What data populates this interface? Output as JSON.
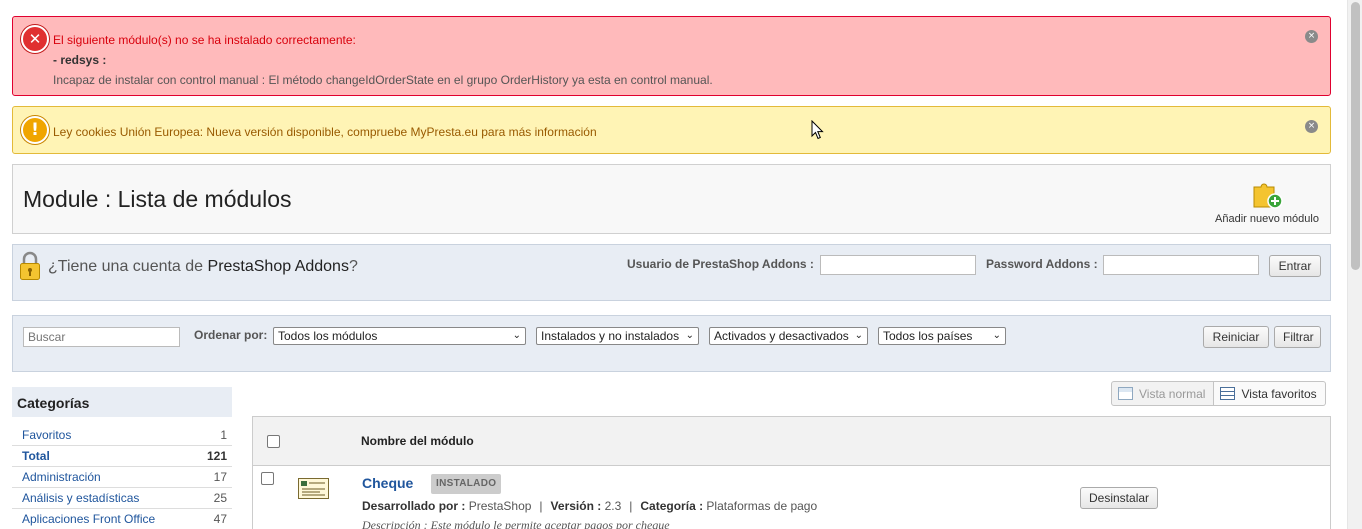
{
  "alerts": {
    "error": {
      "title": "El siguiente módulo(s) no se ha instalado correctamente:",
      "module": "- redsys :",
      "message": "Incapaz de instalar con control manual : El método changeIdOrderState en el grupo OrderHistory ya esta en control manual.",
      "icon": "error-x-icon",
      "close_glyph": "×"
    },
    "warning": {
      "text": "Ley cookies Unión Europea: Nueva versión disponible, compruebe MyPresta.eu para más información",
      "icon": "exclamation-icon",
      "close_glyph": "×"
    }
  },
  "header": {
    "title": "Module : Lista de módulos",
    "add_module_label": "Añadir nuevo módulo"
  },
  "addons": {
    "question_prefix": "¿Tiene una cuenta de ",
    "question_brand": "PrestaShop Addons",
    "question_suffix": "?",
    "user_label": "Usuario de PrestaShop Addons :",
    "password_label": "Password Addons :",
    "user_value": "",
    "password_value": "",
    "submit_label": "Entrar"
  },
  "filters": {
    "search_placeholder": "Buscar",
    "sort_label": "Ordenar por:",
    "select_modules": "Todos los módulos",
    "select_installed": "Instalados y no instalados",
    "select_active": "Activados y desactivados",
    "select_country": "Todos los países",
    "reset_label": "Reiniciar",
    "filter_label": "Filtrar"
  },
  "categories": {
    "title": "Categorías",
    "items": [
      {
        "name": "Favoritos",
        "count": "1"
      },
      {
        "name": "Total",
        "count": "121"
      },
      {
        "name": "Administración",
        "count": "17"
      },
      {
        "name": "Análisis y estadísticas",
        "count": "25"
      },
      {
        "name": "Aplicaciones Front Office",
        "count": "47"
      }
    ]
  },
  "views": {
    "normal_label": "Vista normal",
    "favorites_label": "Vista favoritos"
  },
  "module_table": {
    "column_name": "Nombre del módulo",
    "rows": [
      {
        "name": "Cheque",
        "status": "INSTALADO",
        "developer_label": "Desarrollado por :",
        "developer": "PrestaShop",
        "version_label": "Versión :",
        "version": "2.3",
        "category_label": "Categoría :",
        "category": "Plataformas de pago",
        "description": "Descripción : Este módulo le permite aceptar pagos por cheque",
        "action_label": "Desinstalar"
      }
    ]
  },
  "colors": {
    "error_bg": "#ffbabb",
    "error_text": "#d8000c",
    "warning_bg": "#fff4b5",
    "link_blue": "#20569d",
    "panel_bg": "#e8edf4"
  }
}
